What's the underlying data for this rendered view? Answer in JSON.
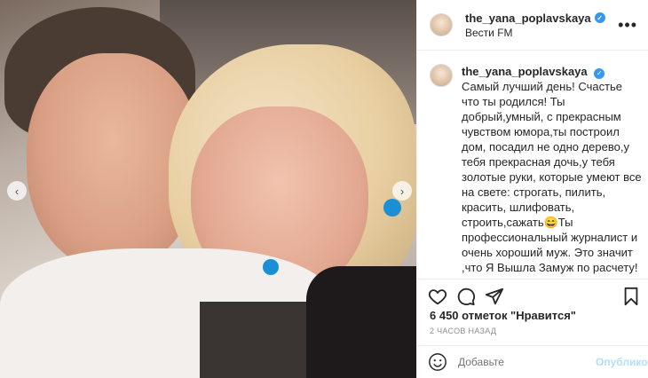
{
  "post": {
    "username": "the_yana_poplavskaya",
    "location": "Вести FM",
    "caption": "Самый лучший день! Счастье что ты родился! Ты добрый,умный, с прекрасным чувством юмора,ты построил дом, посадил не одно дерево,у тебя прекрасная дочь,у тебя золотые руки, которые умеют все на свете: строгать, пилить, красить, шлифовать, строить,сажать😄Ты профессиональный журналист и очень хороший муж. Это значит ,что Я Вышла Замуж по расчету!❤️Я знаю точно только одно -Несчастье любит тишину и закрытые двери... А счастье и любовь всегда открывают все двери и заполняют светом все вокруг! С Днём Рождения и пусть",
    "likes": "6 450 отметок \"Нравится\"",
    "time": "2 ЧАСОВ НАЗАД"
  },
  "comment": {
    "placeholder": "Добавьте",
    "publish_label": "Опубликовать"
  },
  "icons": {
    "verified": "✓",
    "more": "•••",
    "prev": "‹",
    "next": "›"
  },
  "colors": {
    "verified": "#3897f0",
    "publish": "#b2dffc",
    "muted": "#8e8e8e"
  }
}
